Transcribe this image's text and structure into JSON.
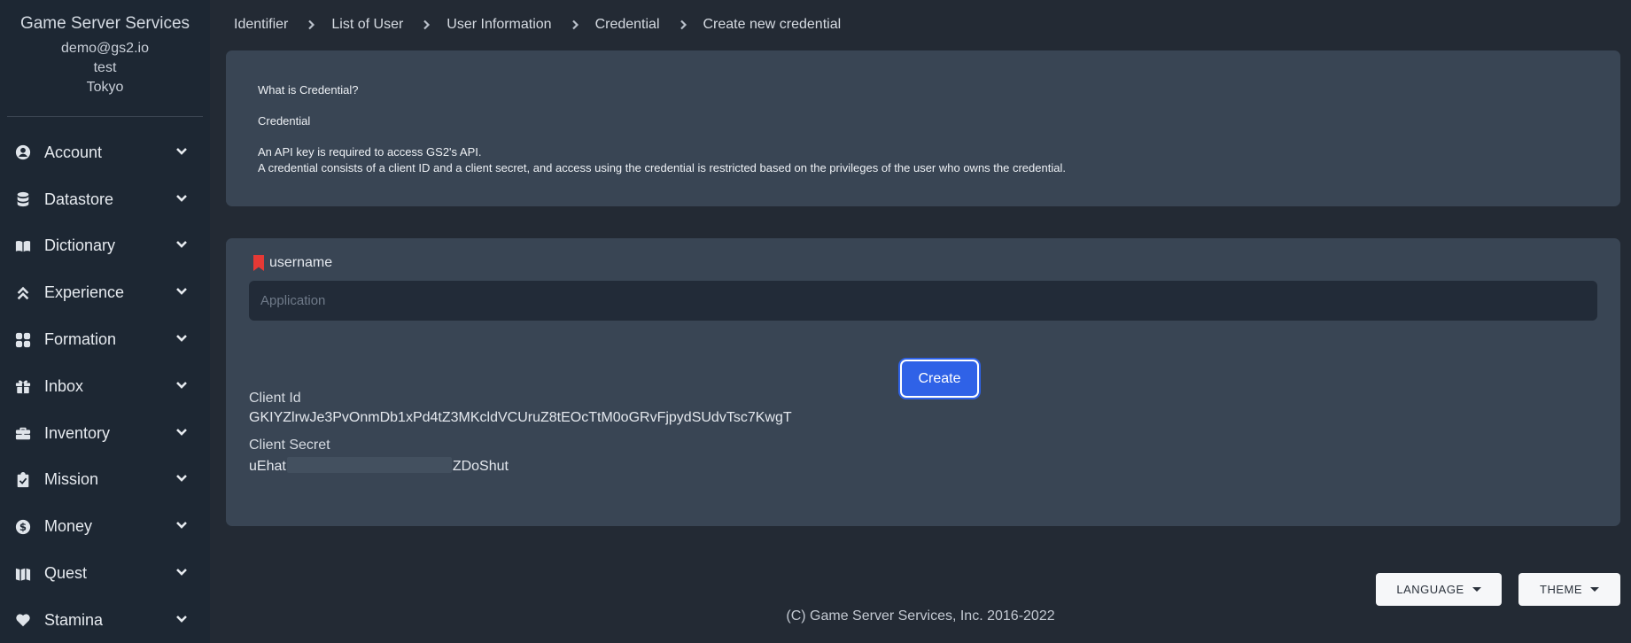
{
  "sidebar": {
    "title": "Game Server Services",
    "email": "demo@gs2.io",
    "project": "test",
    "region": "Tokyo",
    "items": [
      {
        "label": "Account",
        "icon": "user-circle-icon"
      },
      {
        "label": "Datastore",
        "icon": "database-icon"
      },
      {
        "label": "Dictionary",
        "icon": "book-open-icon"
      },
      {
        "label": "Experience",
        "icon": "chevrons-up-icon"
      },
      {
        "label": "Formation",
        "icon": "grid-icon"
      },
      {
        "label": "Inbox",
        "icon": "gift-icon"
      },
      {
        "label": "Inventory",
        "icon": "briefcase-icon"
      },
      {
        "label": "Mission",
        "icon": "clipboard-check-icon"
      },
      {
        "label": "Money",
        "icon": "dollar-circle-icon"
      },
      {
        "label": "Quest",
        "icon": "map-icon"
      },
      {
        "label": "Stamina",
        "icon": "heart-icon"
      }
    ]
  },
  "breadcrumb": [
    "Identifier",
    "List of User",
    "User Information",
    "Credential",
    "Create new credential"
  ],
  "info": {
    "heading": "What is Credential?",
    "subheading": "Credential",
    "line1": "An API key is required to access GS2's API.",
    "line2": "A credential consists of a client ID and a client secret, and access using the credential is restricted based on the privileges of the user who owns the credential."
  },
  "form": {
    "field_label": "username",
    "placeholder": "Application",
    "value": "",
    "required_color": "#e53935",
    "create_label": "Create"
  },
  "result": {
    "client_id_label": "Client Id",
    "client_id": "GKIYZlrwJe3PvOnmDb1xPd4tZ3MKcldVCUruZ8tEOcTtM0oGRvFjpydSUdvTsc7KwgT",
    "client_secret_label": "Client Secret",
    "client_secret_prefix": "uEhat",
    "client_secret_suffix": "ZDoShut"
  },
  "footer": {
    "language_label": "LANGUAGE",
    "theme_label": "THEME",
    "copyright": "(C) Game Server Services, Inc. 2016-2022"
  },
  "colors": {
    "accent": "#2f62e7",
    "sidebar_bg": "#1d2733",
    "page_bg": "#232a34",
    "card_bg": "#394554"
  }
}
